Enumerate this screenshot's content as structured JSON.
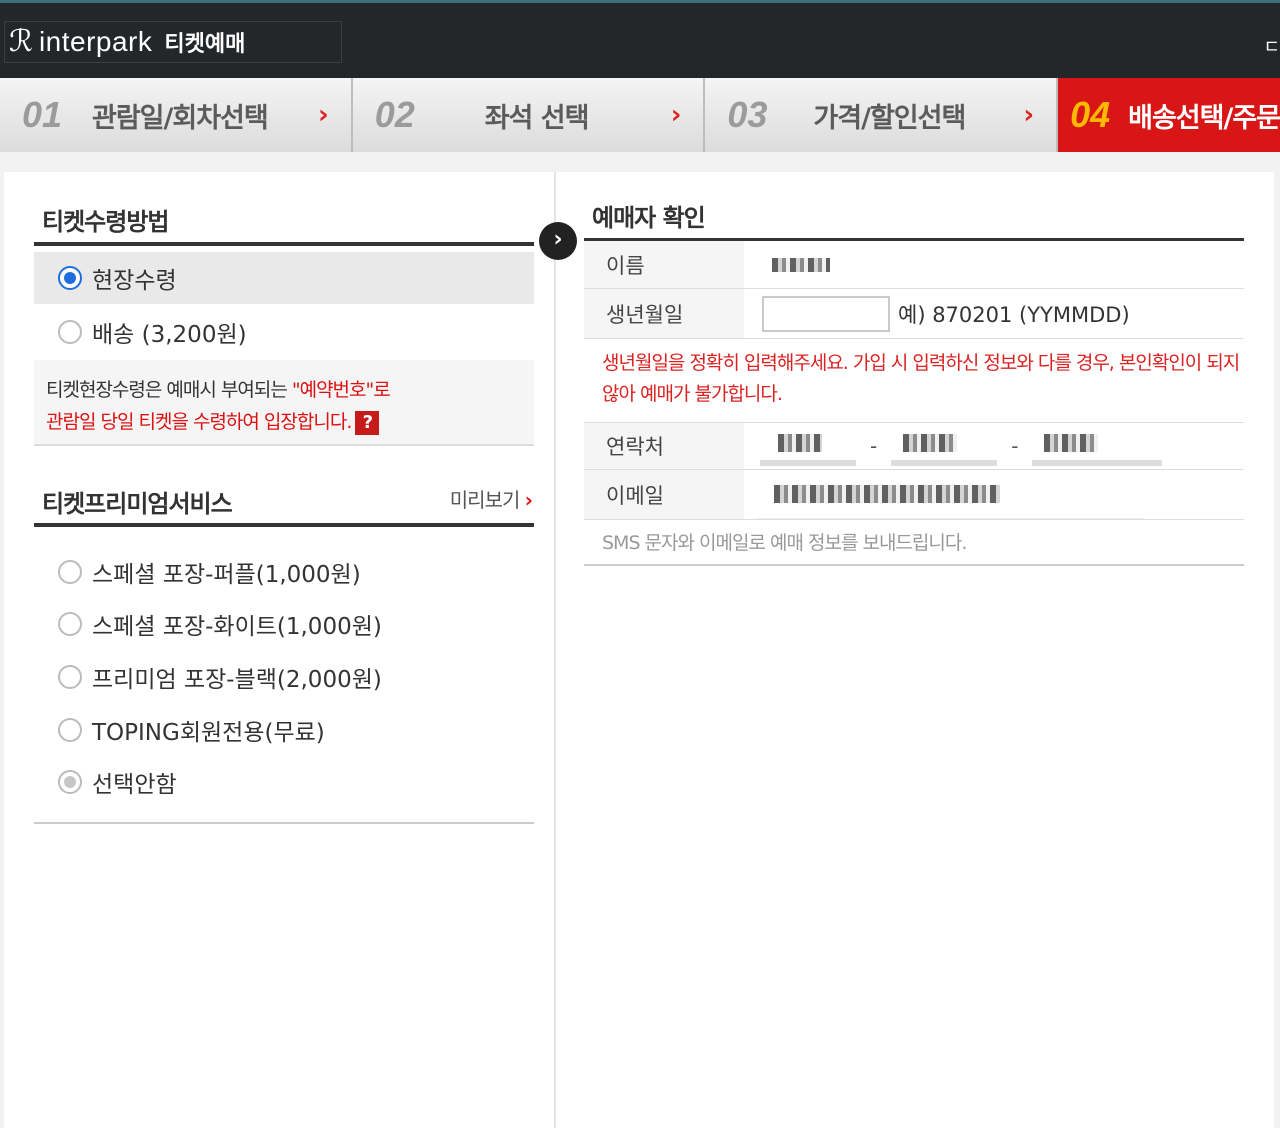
{
  "header": {
    "logo_glyph": "ℛ",
    "brand": "interpark",
    "brand_sub": "티켓예매",
    "right_icon": "ㄷ"
  },
  "steps": [
    {
      "num": "01",
      "label": "관람일/회차선택",
      "arrow": "›"
    },
    {
      "num": "02",
      "label": "좌석 선택",
      "arrow": "›"
    },
    {
      "num": "03",
      "label": "가격/할인선택",
      "arrow": "›"
    },
    {
      "num": "04",
      "label": "배송선택/주문"
    }
  ],
  "receive": {
    "title": "티켓수령방법",
    "options": [
      {
        "label": "현장수령",
        "checked": true
      },
      {
        "label": "배송 (3,200원)",
        "checked": false
      }
    ],
    "info_line1_prefix": "티켓현장수령은 예매시 부여되는 ",
    "info_line1_highlight": "\"예약번호\"로",
    "info_line2": "관람일 당일 티켓을 수령하여 입장합니다.",
    "help_icon": "?"
  },
  "premium": {
    "title": "티켓프리미엄서비스",
    "preview": "미리보기",
    "preview_chev": "›",
    "options": [
      {
        "label": "스페셜 포장-퍼플(1,000원)"
      },
      {
        "label": "스페셜 포장-화이트(1,000원)"
      },
      {
        "label": "프리미엄 포장-블랙(2,000원)"
      },
      {
        "label": "TOPING회원전용(무료)"
      },
      {
        "label": "선택안함",
        "checked": true
      }
    ]
  },
  "booker": {
    "title": "예매자 확인",
    "divider_icon": "›",
    "name_label": "이름",
    "birth_label": "생년월일",
    "birth_value": "",
    "birth_example": "예) 870201 (YYMMDD)",
    "warning": "생년월일을 정확히 입력해주세요. 가입 시 입력하신 정보와 다를 경우, 본인확인이 되지 않아 예매가 불가합니다.",
    "phone_label": "연락처",
    "phone_sep": "-",
    "email_label": "이메일",
    "sms_note": "SMS 문자와 이메일로 예매 정보를 보내드립니다."
  }
}
